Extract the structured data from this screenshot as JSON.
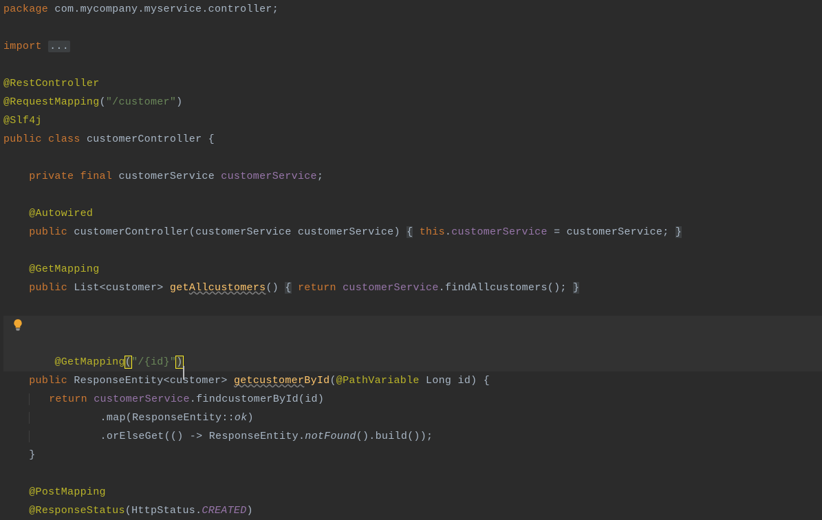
{
  "code": {
    "package_kw": "package",
    "package_val": " com.mycompany.myservice.controller",
    "semi": ";",
    "import_kw": "import",
    "import_fold": "...",
    "ann_rest": "@RestController",
    "ann_reqmap": "@RequestMapping",
    "reqmap_path": "\"/customer\"",
    "ann_slf4j": "@Slf4j",
    "public_kw": "public",
    "class_kw": "class",
    "class_name": " customerController ",
    "lbrace": "{",
    "rbrace": "}",
    "private_kw": "private",
    "final_kw": "final",
    "svc_type": " customerService ",
    "svc_field": "customerService",
    "ann_autowired": "@Autowired",
    "ctor_name": "customerController",
    "lparen": "(",
    "rparen": ")",
    "ctor_param_type": "customerService ",
    "ctor_param_name": "customerService",
    "this_kw": "this",
    "dot": ".",
    "assign": " = ",
    "ann_getmapping": "@GetMapping",
    "list_type": "List",
    "lt": "<",
    "gt": ">",
    "customer_type": "customer",
    "getall_name": "getAllcustomers",
    "getall_underline": "Allcustomers",
    "return_kw": "return",
    "findall_call": "findAllcustomers",
    "getmapping_path": "\"/{id}\"",
    "respentity": "ResponseEntity",
    "getbyid_name": "getcustomerById",
    "getbyid_prefix": "get",
    "getbyid_underline": "customer",
    "getbyid_suffix": "ById",
    "ann_pathvar": "@PathVariable",
    "long_type": " Long ",
    "id_param": "id",
    "findbyid_call": "findcustomerById",
    "map_call": "map",
    "colon2": "::",
    "ok_ref": "ok",
    "orelseget": "orElseGet",
    "arrow": " -> ",
    "empty_parens": "()",
    "notfound": "notFound",
    "build": "build",
    "ann_postmapping": "@PostMapping",
    "ann_respstatus": "@ResponseStatus",
    "httpstatus": "HttpStatus",
    "created": "CREATED",
    "space": " "
  }
}
